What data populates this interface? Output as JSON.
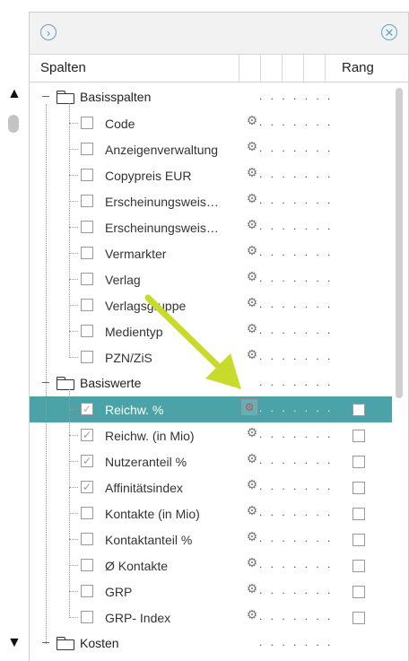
{
  "header": {
    "spalten": "Spalten",
    "rang": "Rang"
  },
  "scroll": {
    "up": "▲",
    "down": "▼"
  },
  "buttons": {
    "expand_icon": "chevron-right-circle-icon",
    "close_icon": "close-circle-icon"
  },
  "colors": {
    "selected_row": "#4ba3a8",
    "arrow": "#c8da2b",
    "accent": "#5ea3c8"
  },
  "groups": [
    {
      "label": "Basisspalten"
    },
    {
      "label": "Basiswerte"
    },
    {
      "label": "Kosten"
    }
  ],
  "basisspalten_items": [
    {
      "label": "Code",
      "checked": false
    },
    {
      "label": "Anzeigenverwaltung",
      "checked": false
    },
    {
      "label": "Copypreis EUR",
      "checked": false
    },
    {
      "label": "Erscheinungsweis…",
      "checked": false
    },
    {
      "label": "Erscheinungsweis…",
      "checked": false
    },
    {
      "label": "Vermarkter",
      "checked": false
    },
    {
      "label": "Verlag",
      "checked": false
    },
    {
      "label": "Verlagsgruppe",
      "checked": false
    },
    {
      "label": "Medientyp",
      "checked": false
    },
    {
      "label": "PZN/ZiS",
      "checked": false
    }
  ],
  "basiswerte_items": [
    {
      "label": "Reichw. %",
      "checked": true,
      "selected": true,
      "rang_checked": false
    },
    {
      "label": "Reichw. (in Mio)",
      "checked": true,
      "rang_checked": false
    },
    {
      "label": "Nutzeranteil %",
      "checked": true,
      "rang_checked": false
    },
    {
      "label": "Affinitätsindex",
      "checked": true,
      "rang_checked": false
    },
    {
      "label": "Kontakte (in Mio)",
      "checked": false,
      "rang_checked": false
    },
    {
      "label": "Kontaktanteil %",
      "checked": false,
      "rang_checked": false
    },
    {
      "label": "Ø Kontakte",
      "checked": false,
      "rang_checked": false
    },
    {
      "label": "GRP",
      "checked": false,
      "rang_checked": false
    },
    {
      "label": "GRP- Index",
      "checked": false,
      "rang_checked": false
    }
  ],
  "dots": ". .   . .   . .   .",
  "gear_icon": "gear-icon",
  "check_mark": "✓",
  "minus_sign": "–"
}
